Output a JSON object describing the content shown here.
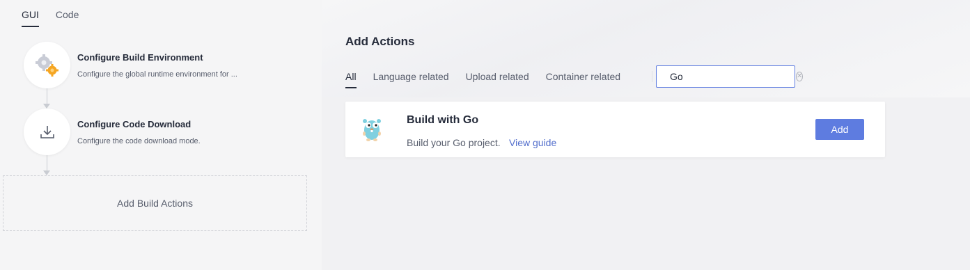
{
  "left_tabs": [
    {
      "label": "GUI",
      "active": true
    },
    {
      "label": "Code",
      "active": false
    }
  ],
  "steps": [
    {
      "title": "Configure Build Environment",
      "desc": "Configure the global runtime environment for ...",
      "icon": "gears-icon"
    },
    {
      "title": "Configure Code Download",
      "desc": "Configure the code download mode.",
      "icon": "download-icon"
    }
  ],
  "add_build_label": "Add Build Actions",
  "right": {
    "heading": "Add Actions",
    "filters": [
      {
        "label": "All",
        "active": true
      },
      {
        "label": "Language related",
        "active": false
      },
      {
        "label": "Upload related",
        "active": false
      },
      {
        "label": "Container related",
        "active": false
      }
    ],
    "search": {
      "value": "Go",
      "icon": "search-icon"
    },
    "card": {
      "title": "Build with Go",
      "desc": "Build your Go project.",
      "link": "View guide",
      "button": "Add",
      "icon": "gopher-icon"
    }
  },
  "colors": {
    "accent": "#5e7ce0",
    "link": "#526ecc",
    "text": "#252b3a",
    "muted": "#575d6c"
  }
}
